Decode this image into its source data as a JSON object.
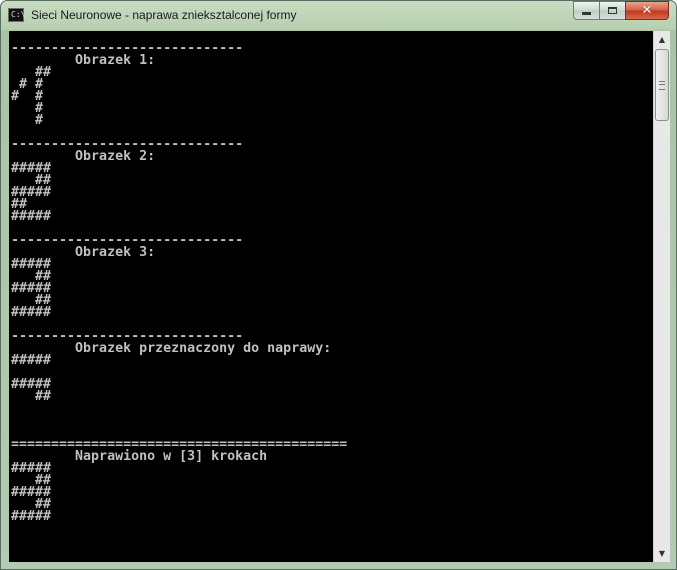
{
  "window": {
    "title": "Sieci Neuronowe - naprawa znieksztalconej formy",
    "icon": "console-window-icon",
    "icon_prompt": "C:\\",
    "buttons": {
      "minimize": "minimize-icon",
      "maximize": "maximize-icon",
      "close": "close-icon"
    },
    "close_glyph": "✕"
  },
  "console": {
    "lines": [
      "-----------------------------",
      "        Obrazek 1:",
      "   ##",
      " # #",
      "#  #",
      "   #",
      "   #",
      "",
      "-----------------------------",
      "        Obrazek 2:",
      "#####",
      "   ##",
      "#####",
      "##",
      "#####",
      "",
      "-----------------------------",
      "        Obrazek 3:",
      "#####",
      "   ##",
      "#####",
      "   ##",
      "#####",
      "",
      "-----------------------------",
      "        Obrazek przeznaczony do naprawy:",
      "#####",
      "",
      "#####",
      "   ##",
      "",
      "",
      "",
      "==========================================",
      "        Naprawiono w [3] krokach",
      "#####",
      "   ##",
      "#####",
      "   ##",
      "#####"
    ]
  },
  "scrollbar": {
    "up_arrow": "▲",
    "down_arrow": "▼",
    "position": 0
  },
  "colors": {
    "console_bg": "#000000",
    "console_fg": "#c0c0c0",
    "frame": "#b7cfb0",
    "close": "#c0391d"
  }
}
